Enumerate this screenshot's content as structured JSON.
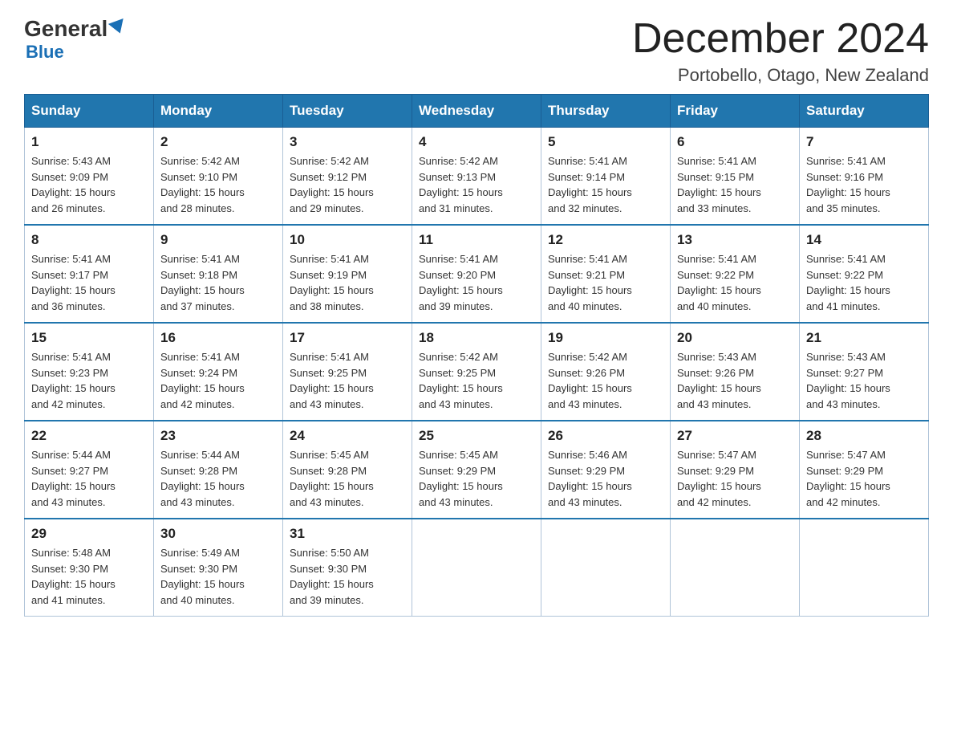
{
  "header": {
    "logo_general": "General",
    "logo_blue": "Blue",
    "month_title": "December 2024",
    "location": "Portobello, Otago, New Zealand"
  },
  "weekdays": [
    "Sunday",
    "Monday",
    "Tuesday",
    "Wednesday",
    "Thursday",
    "Friday",
    "Saturday"
  ],
  "weeks": [
    [
      {
        "day": "1",
        "sunrise": "5:43 AM",
        "sunset": "9:09 PM",
        "daylight": "15 hours and 26 minutes."
      },
      {
        "day": "2",
        "sunrise": "5:42 AM",
        "sunset": "9:10 PM",
        "daylight": "15 hours and 28 minutes."
      },
      {
        "day": "3",
        "sunrise": "5:42 AM",
        "sunset": "9:12 PM",
        "daylight": "15 hours and 29 minutes."
      },
      {
        "day": "4",
        "sunrise": "5:42 AM",
        "sunset": "9:13 PM",
        "daylight": "15 hours and 31 minutes."
      },
      {
        "day": "5",
        "sunrise": "5:41 AM",
        "sunset": "9:14 PM",
        "daylight": "15 hours and 32 minutes."
      },
      {
        "day": "6",
        "sunrise": "5:41 AM",
        "sunset": "9:15 PM",
        "daylight": "15 hours and 33 minutes."
      },
      {
        "day": "7",
        "sunrise": "5:41 AM",
        "sunset": "9:16 PM",
        "daylight": "15 hours and 35 minutes."
      }
    ],
    [
      {
        "day": "8",
        "sunrise": "5:41 AM",
        "sunset": "9:17 PM",
        "daylight": "15 hours and 36 minutes."
      },
      {
        "day": "9",
        "sunrise": "5:41 AM",
        "sunset": "9:18 PM",
        "daylight": "15 hours and 37 minutes."
      },
      {
        "day": "10",
        "sunrise": "5:41 AM",
        "sunset": "9:19 PM",
        "daylight": "15 hours and 38 minutes."
      },
      {
        "day": "11",
        "sunrise": "5:41 AM",
        "sunset": "9:20 PM",
        "daylight": "15 hours and 39 minutes."
      },
      {
        "day": "12",
        "sunrise": "5:41 AM",
        "sunset": "9:21 PM",
        "daylight": "15 hours and 40 minutes."
      },
      {
        "day": "13",
        "sunrise": "5:41 AM",
        "sunset": "9:22 PM",
        "daylight": "15 hours and 40 minutes."
      },
      {
        "day": "14",
        "sunrise": "5:41 AM",
        "sunset": "9:22 PM",
        "daylight": "15 hours and 41 minutes."
      }
    ],
    [
      {
        "day": "15",
        "sunrise": "5:41 AM",
        "sunset": "9:23 PM",
        "daylight": "15 hours and 42 minutes."
      },
      {
        "day": "16",
        "sunrise": "5:41 AM",
        "sunset": "9:24 PM",
        "daylight": "15 hours and 42 minutes."
      },
      {
        "day": "17",
        "sunrise": "5:41 AM",
        "sunset": "9:25 PM",
        "daylight": "15 hours and 43 minutes."
      },
      {
        "day": "18",
        "sunrise": "5:42 AM",
        "sunset": "9:25 PM",
        "daylight": "15 hours and 43 minutes."
      },
      {
        "day": "19",
        "sunrise": "5:42 AM",
        "sunset": "9:26 PM",
        "daylight": "15 hours and 43 minutes."
      },
      {
        "day": "20",
        "sunrise": "5:43 AM",
        "sunset": "9:26 PM",
        "daylight": "15 hours and 43 minutes."
      },
      {
        "day": "21",
        "sunrise": "5:43 AM",
        "sunset": "9:27 PM",
        "daylight": "15 hours and 43 minutes."
      }
    ],
    [
      {
        "day": "22",
        "sunrise": "5:44 AM",
        "sunset": "9:27 PM",
        "daylight": "15 hours and 43 minutes."
      },
      {
        "day": "23",
        "sunrise": "5:44 AM",
        "sunset": "9:28 PM",
        "daylight": "15 hours and 43 minutes."
      },
      {
        "day": "24",
        "sunrise": "5:45 AM",
        "sunset": "9:28 PM",
        "daylight": "15 hours and 43 minutes."
      },
      {
        "day": "25",
        "sunrise": "5:45 AM",
        "sunset": "9:29 PM",
        "daylight": "15 hours and 43 minutes."
      },
      {
        "day": "26",
        "sunrise": "5:46 AM",
        "sunset": "9:29 PM",
        "daylight": "15 hours and 43 minutes."
      },
      {
        "day": "27",
        "sunrise": "5:47 AM",
        "sunset": "9:29 PM",
        "daylight": "15 hours and 42 minutes."
      },
      {
        "day": "28",
        "sunrise": "5:47 AM",
        "sunset": "9:29 PM",
        "daylight": "15 hours and 42 minutes."
      }
    ],
    [
      {
        "day": "29",
        "sunrise": "5:48 AM",
        "sunset": "9:30 PM",
        "daylight": "15 hours and 41 minutes."
      },
      {
        "day": "30",
        "sunrise": "5:49 AM",
        "sunset": "9:30 PM",
        "daylight": "15 hours and 40 minutes."
      },
      {
        "day": "31",
        "sunrise": "5:50 AM",
        "sunset": "9:30 PM",
        "daylight": "15 hours and 39 minutes."
      },
      null,
      null,
      null,
      null
    ]
  ],
  "labels": {
    "sunrise": "Sunrise:",
    "sunset": "Sunset:",
    "daylight": "Daylight:"
  }
}
